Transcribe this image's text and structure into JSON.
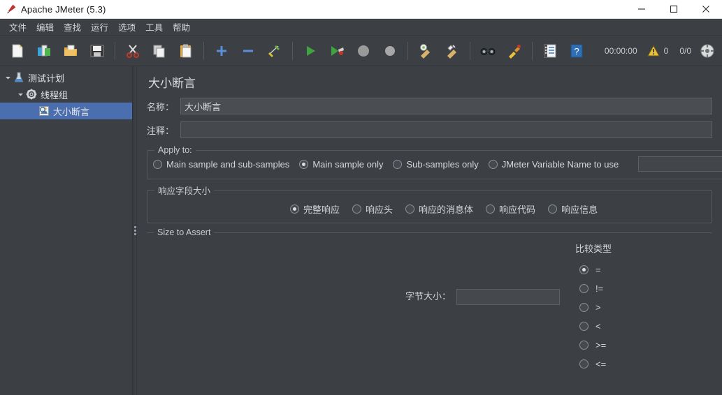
{
  "window": {
    "title": "Apache JMeter (5.3)",
    "app_icon": "jmeter-feather-icon",
    "minimize_label": "–",
    "maximize_label": "❐",
    "close_label": "✕"
  },
  "menubar": {
    "items": [
      {
        "label": "文件",
        "name": "menu-file"
      },
      {
        "label": "编辑",
        "name": "menu-edit"
      },
      {
        "label": "查找",
        "name": "menu-search"
      },
      {
        "label": "运行",
        "name": "menu-run"
      },
      {
        "label": "选项",
        "name": "menu-options"
      },
      {
        "label": "工具",
        "name": "menu-tools"
      },
      {
        "label": "帮助",
        "name": "menu-help"
      }
    ]
  },
  "toolbar": {
    "buttons": [
      {
        "name": "new-icon",
        "title": "New"
      },
      {
        "name": "templates-icon",
        "title": "Templates"
      },
      {
        "name": "open-icon",
        "title": "Open"
      },
      {
        "name": "save-icon",
        "title": "Save"
      },
      {
        "name": "cut-icon",
        "title": "Cut"
      },
      {
        "name": "copy-icon",
        "title": "Copy"
      },
      {
        "name": "paste-icon",
        "title": "Paste"
      },
      {
        "name": "expand-all-icon",
        "title": "Expand all"
      },
      {
        "name": "collapse-all-icon",
        "title": "Collapse all"
      },
      {
        "name": "toggle-icon",
        "title": "Toggle"
      },
      {
        "name": "start-icon",
        "title": "Start"
      },
      {
        "name": "start-no-pauses-icon",
        "title": "Start no pauses"
      },
      {
        "name": "stop-icon",
        "title": "Stop"
      },
      {
        "name": "shutdown-icon",
        "title": "Shutdown"
      },
      {
        "name": "clear-icon",
        "title": "Clear"
      },
      {
        "name": "clear-all-icon",
        "title": "Clear all"
      },
      {
        "name": "search-icon",
        "title": "Search"
      },
      {
        "name": "search-reset-icon",
        "title": "Reset search"
      },
      {
        "name": "function-helper-icon",
        "title": "Function helper dialog"
      },
      {
        "name": "help-icon",
        "title": "Help"
      }
    ],
    "status": {
      "elapsed_time": "00:00:00",
      "warning_icon": "warning-triangle-icon",
      "warning_count": "0",
      "threads": "0/0",
      "remote_icon": "connection-ball-icon"
    }
  },
  "sidebar": {
    "tree": [
      {
        "label": "测试计划",
        "name": "tree-node-test-plan",
        "icon": "test-plan-icon",
        "indent": 0,
        "toggle": "▼",
        "selected": false
      },
      {
        "label": "线程组",
        "name": "tree-node-thread-group",
        "icon": "thread-group-gear-icon",
        "indent": 1,
        "toggle": "▼",
        "selected": false
      },
      {
        "label": "大小断言",
        "name": "tree-node-size-assertion",
        "icon": "size-assertion-icon",
        "indent": 2,
        "toggle": "",
        "selected": true
      }
    ]
  },
  "main": {
    "panel_title": "大小断言",
    "name_label": "名称：",
    "name_value": "大小断言",
    "comment_label": "注释：",
    "comment_value": "",
    "apply_to": {
      "legend": "Apply to:",
      "options": [
        {
          "label": "Main sample and sub-samples",
          "name": "radio-main-and-sub",
          "checked": false
        },
        {
          "label": "Main sample only",
          "name": "radio-main-only",
          "checked": true
        },
        {
          "label": "Sub-samples only",
          "name": "radio-sub-only",
          "checked": false
        },
        {
          "label": "JMeter Variable Name to use",
          "name": "radio-jmeter-variable",
          "checked": false
        }
      ],
      "variable_value": ""
    },
    "response_field": {
      "legend": "响应字段大小",
      "options": [
        {
          "label": "完整响应",
          "name": "radio-full-response",
          "checked": true
        },
        {
          "label": "响应头",
          "name": "radio-response-headers",
          "checked": false
        },
        {
          "label": "响应的消息体",
          "name": "radio-response-body",
          "checked": false
        },
        {
          "label": "响应代码",
          "name": "radio-response-code",
          "checked": false
        },
        {
          "label": "响应信息",
          "name": "radio-response-message",
          "checked": false
        }
      ]
    },
    "size_to_assert": {
      "legend": "Size to Assert",
      "bytes_label": "字节大小：",
      "bytes_value": "",
      "comparison_title": "比较类型",
      "operators": [
        {
          "label": "=",
          "name": "radio-op-equal",
          "checked": true
        },
        {
          "label": "!=",
          "name": "radio-op-not-equal",
          "checked": false
        },
        {
          "label": ">",
          "name": "radio-op-greater",
          "checked": false
        },
        {
          "label": "<",
          "name": "radio-op-less",
          "checked": false
        },
        {
          "label": ">=",
          "name": "radio-op-greater-or-equal",
          "checked": false
        },
        {
          "label": "<=",
          "name": "radio-op-less-or-equal",
          "checked": false
        }
      ]
    }
  },
  "colors": {
    "window_bg": "#3c4044",
    "selection_blue": "#4b6eaf",
    "text": "#d4d7d9",
    "input_bg": "#45494d",
    "border": "#55595d"
  }
}
